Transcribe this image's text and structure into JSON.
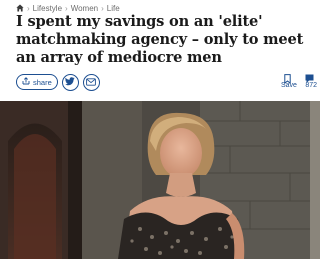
{
  "breadcrumb": {
    "items": [
      "Lifestyle",
      "Women",
      "Life"
    ],
    "separator": "›",
    "home_icon": "home-icon"
  },
  "headline": "I spent my savings on an 'elite' matchmaking agency – only to meet an array of mediocre men",
  "share": {
    "share_label": "share",
    "icons": [
      "share-icon",
      "twitter-icon",
      "email-icon"
    ]
  },
  "actions": {
    "save_label": "Save",
    "comment_count": "872",
    "icons": [
      "bookmark-icon",
      "comment-icon"
    ]
  },
  "colors": {
    "accent": "#1d4f91",
    "text": "#1a1a1a",
    "muted": "#6d6d6d"
  }
}
